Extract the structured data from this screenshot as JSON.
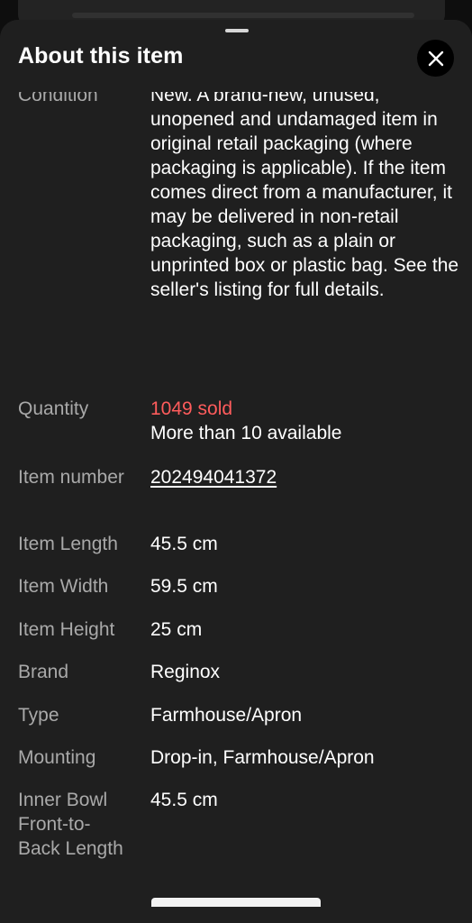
{
  "sheet": {
    "title": "About this item",
    "close_icon": "close-icon"
  },
  "specifics": [
    {
      "label": "Condition",
      "value": "New. A brand-new, unused, unopened and undamaged item in original retail packaging (where packaging is applicable). If the item comes direct from a manufacturer, it may be delivered in non-retail packaging, such as a plain or unprinted box or plastic bag. See the seller's listing for full details."
    },
    {
      "label": "Quantity",
      "sold": "1049 sold",
      "available": "More than 10 available"
    },
    {
      "label": "Item number",
      "value": "202494041372"
    },
    {
      "label": "Item Length",
      "value": "45.5 cm"
    },
    {
      "label": "Item Width",
      "value": "59.5 cm"
    },
    {
      "label": "Item Height",
      "value": "25 cm"
    },
    {
      "label": "Brand",
      "value": "Reginox"
    },
    {
      "label": "Type",
      "value": "Farmhouse/Apron"
    },
    {
      "label": "Mounting",
      "value": "Drop-in, Farmhouse/Apron"
    },
    {
      "label": "Inner Bowl Front-to-Back Length",
      "value": "45.5 cm"
    }
  ],
  "colors": {
    "sheet_background": "#1f1f1f",
    "label": "#a9a9a9",
    "value": "#ffffff",
    "sold_accent": "#ff5c5c"
  }
}
